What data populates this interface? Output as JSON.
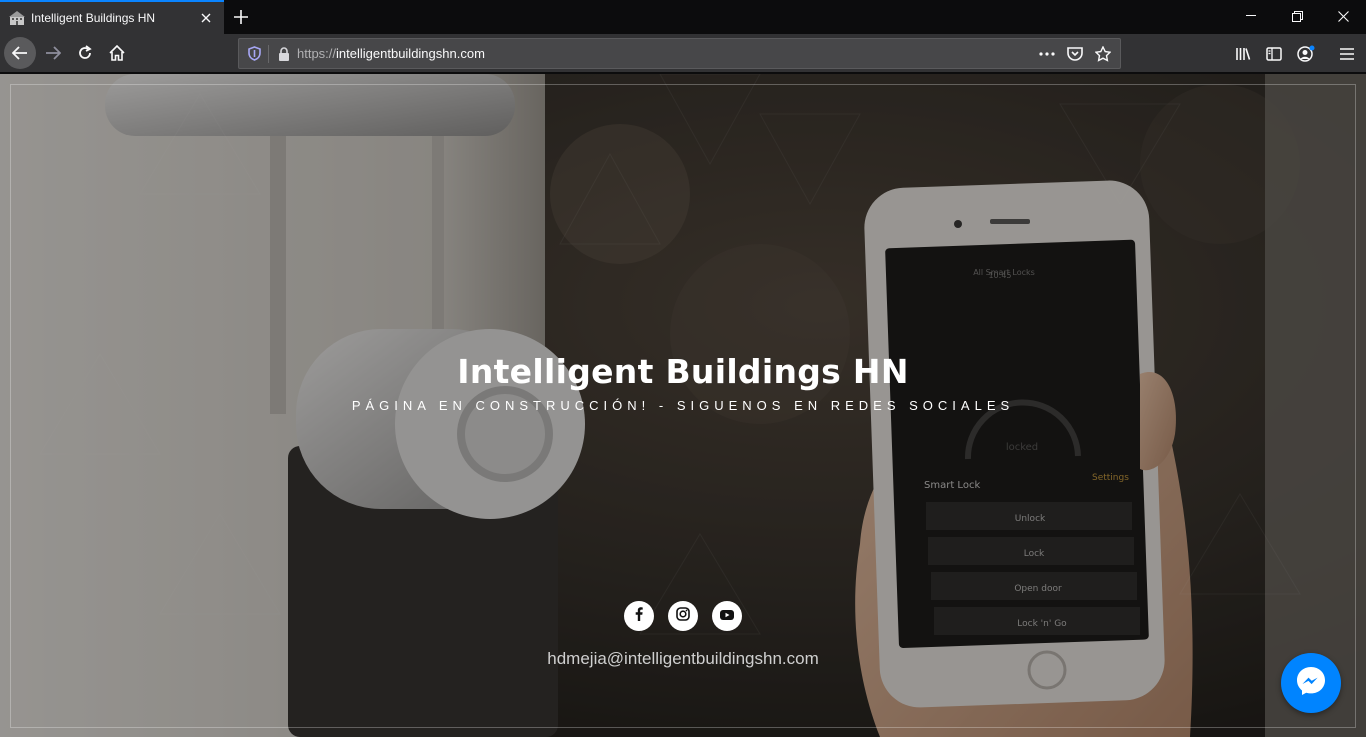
{
  "browser": {
    "tab": {
      "title": "Intelligent Buildings HN",
      "favicon": "building-favicon-icon"
    },
    "url": {
      "scheme": "https://",
      "host": "intelligentbuildingshn.com"
    },
    "colors": {
      "tab_accent": "#0a84ff",
      "toolbar": "#323234",
      "urlbar": "#474749"
    }
  },
  "page": {
    "title": "Intelligent Buildings HN",
    "subtitle": "PÁGINA EN CONSTRUCCIÓN! - SIGUENOS EN REDES SOCIALES",
    "socials": [
      {
        "name": "facebook",
        "icon": "facebook-icon"
      },
      {
        "name": "instagram",
        "icon": "instagram-icon"
      },
      {
        "name": "youtube",
        "icon": "youtube-icon"
      }
    ],
    "email": "hdmejia@intelligentbuildingshn.com",
    "messenger": {
      "icon": "messenger-icon",
      "color": "#0084ff"
    },
    "phone_screen": {
      "time": "10:45",
      "header": "All Smart Locks",
      "status": "locked",
      "lock_name": "Smart Lock",
      "settings": "Settings",
      "buttons": [
        "Unlock",
        "Lock",
        "Open door",
        "Lock 'n' Go"
      ]
    }
  }
}
